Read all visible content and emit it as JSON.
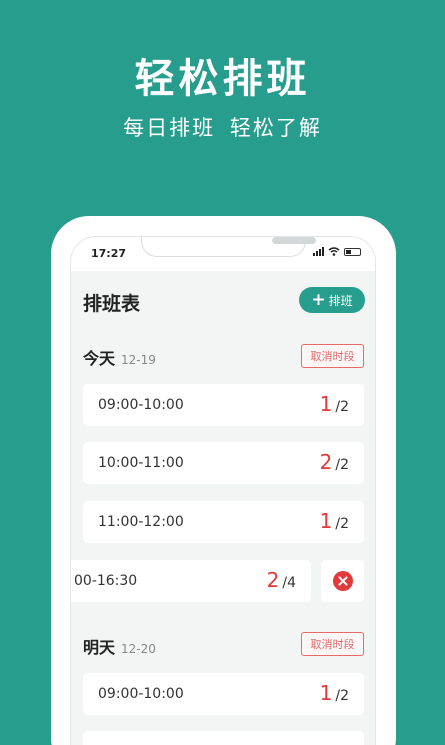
{
  "hero": {
    "title": "轻松排班",
    "subtitle": "每日排班  轻松了解"
  },
  "statusbar": {
    "time": "17:27"
  },
  "page": {
    "title": "排班表",
    "add_button": {
      "icon": "plus-icon",
      "label": "排班"
    }
  },
  "days": [
    {
      "name": "今天",
      "date": "12-19",
      "cancel_label": "取消时段",
      "slots": [
        {
          "range": "09:00-10:00",
          "filled": "1",
          "total": "/2"
        },
        {
          "range": "10:00-11:00",
          "filled": "2",
          "total": "/2"
        },
        {
          "range": "11:00-12:00",
          "filled": "1",
          "total": "/2"
        },
        {
          "range": "00-16:30",
          "filled": "2",
          "total": "/4"
        }
      ]
    },
    {
      "name": "明天",
      "date": "12-20",
      "cancel_label": "取消时段",
      "slots": [
        {
          "range": "09:00-10:00",
          "filled": "1",
          "total": "/2"
        }
      ]
    }
  ],
  "colors": {
    "brand": "#279e8d",
    "accent_red": "#e2393b"
  }
}
